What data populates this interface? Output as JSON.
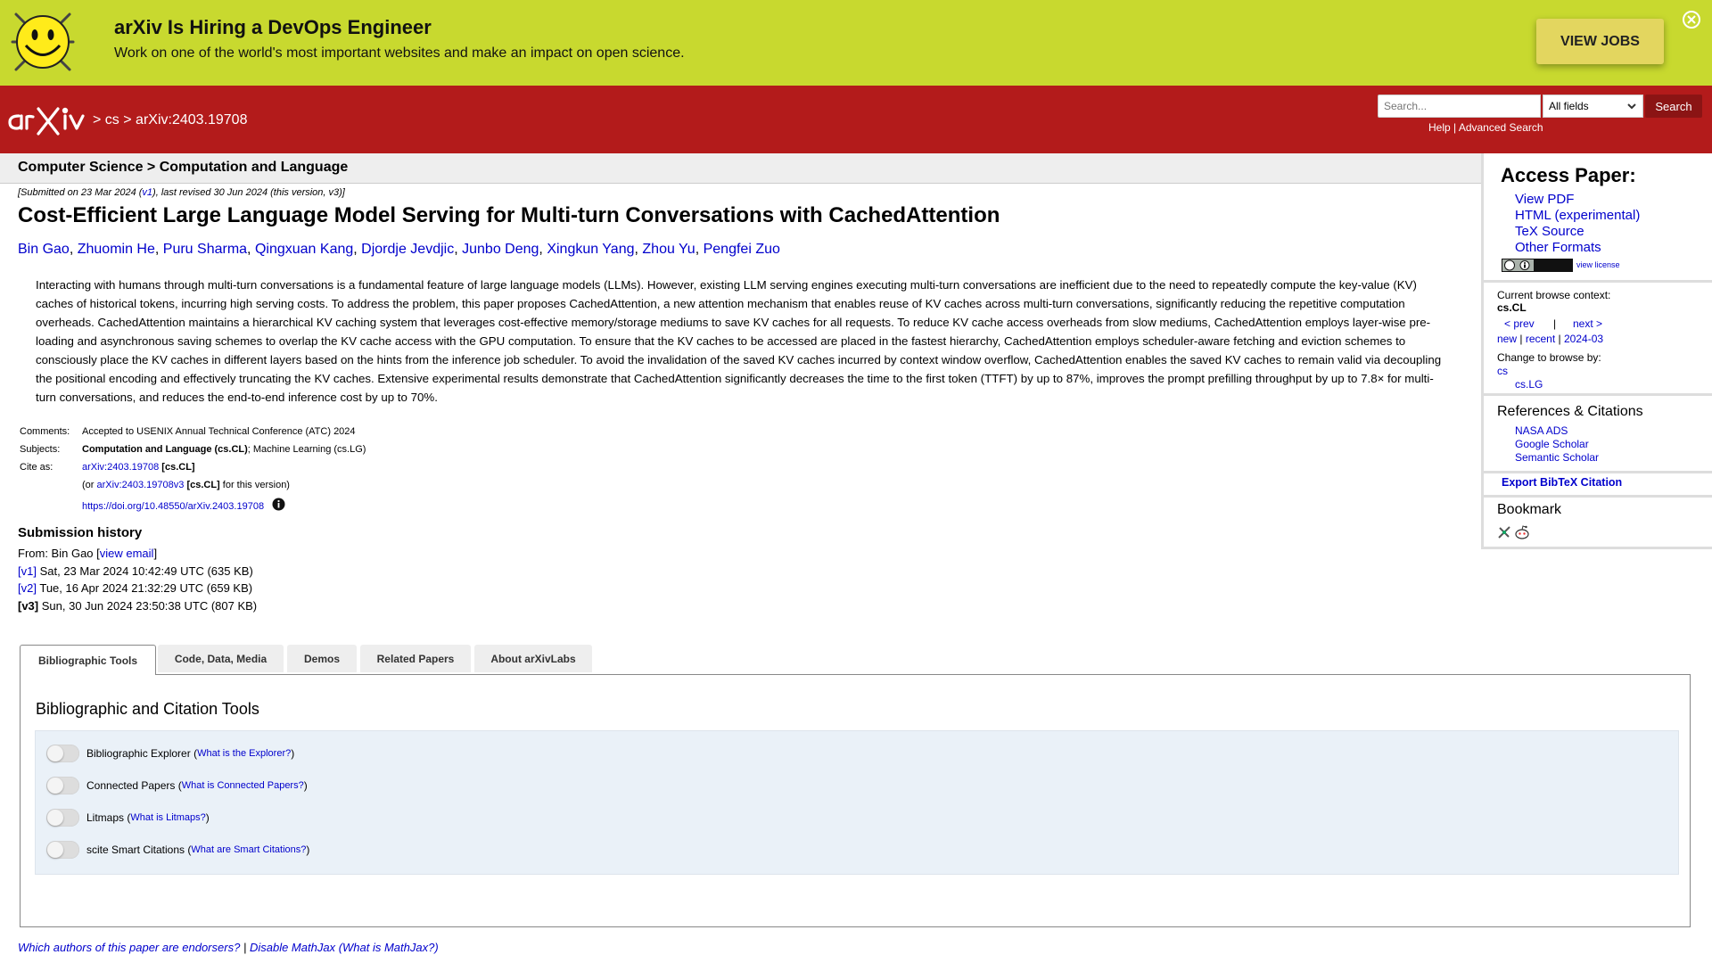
{
  "banner": {
    "title": "arXiv Is Hiring a DevOps Engineer",
    "text": "Work on one of the world's most important websites and make an impact on open science.",
    "button": "VIEW JOBS"
  },
  "header": {
    "breadcrumb_sep": ">",
    "crumb_cs": "cs",
    "crumb_id": "arXiv:2403.19708",
    "search_placeholder": "Search...",
    "field_select": "All fields",
    "search_button": "Search",
    "help": "Help",
    "link_sep": "|",
    "advanced": "Advanced Search"
  },
  "subheader": {
    "title": "Computer Science > Computation and Language"
  },
  "dateline": {
    "part1": "[Submitted on 23 Mar 2024 (",
    "v1": "v1",
    "part2": "), last revised 30 Jun 2024 (this version, v3)]"
  },
  "paper": {
    "title": "Cost-Efficient Large Language Model Serving for Multi-turn Conversations with CachedAttention",
    "authors": [
      "Bin Gao",
      "Zhuomin He",
      "Puru Sharma",
      "Qingxuan Kang",
      "Djordje Jevdjic",
      "Junbo Deng",
      "Xingkun Yang",
      "Zhou Yu",
      "Pengfei Zuo"
    ],
    "author_sep": ",",
    "abstract": "Interacting with humans through multi-turn conversations is a fundamental feature of large language models (LLMs). However, existing LLM serving engines executing multi-turn conversations are inefficient due to the need to repeatedly compute the key-value (KV) caches of historical tokens, incurring high serving costs. To address the problem, this paper proposes CachedAttention, a new attention mechanism that enables reuse of KV caches across multi-turn conversations, significantly reducing the repetitive computation overheads. CachedAttention maintains a hierarchical KV caching system that leverages cost-effective memory/storage mediums to save KV caches for all requests. To reduce KV cache access overheads from slow mediums, CachedAttention employs layer-wise pre-loading and asynchronous saving schemes to overlap the KV cache access with the GPU computation. To ensure that the KV caches to be accessed are placed in the fastest hierarchy, CachedAttention employs scheduler-aware fetching and eviction schemes to consciously place the KV caches in different layers based on the hints from the inference job scheduler. To avoid the invalidation of the saved KV caches incurred by context window overflow, CachedAttention enables the saved KV caches to remain valid via decoupling the positional encoding and effectively truncating the KV caches. Extensive experimental results demonstrate that CachedAttention significantly decreases the time to the first token (TTFT) by up to 87%, improves the prompt prefilling throughput by up to 7.8× for multi-turn conversations, and reduces the end-to-end inference cost by up to 70%."
  },
  "meta": {
    "comments_label": "Comments:",
    "comments": "Accepted to USENIX Annual Technical Conference (ATC) 2024",
    "subjects_label": "Subjects:",
    "subject_primary": "Computation and Language (cs.CL)",
    "subject_secondary": "; Machine Learning (cs.LG)",
    "cite_label": "Cite as:",
    "cite_id": "arXiv:2403.19708",
    "cite_tag": "[cs.CL]",
    "or_open": "(or",
    "cite_v3": "arXiv:2403.19708v3",
    "cite_v3_tag": "[cs.CL]",
    "cite_v3_tail": "for this version)",
    "doi": "https://doi.org/10.48550/arXiv.2403.19708"
  },
  "submission": {
    "heading": "Submission history",
    "from_prefix": "From: Bin Gao [",
    "view_email": "view email",
    "from_suffix": "]",
    "versions": [
      {
        "tag": "[v1]",
        "text": "Sat, 23 Mar 2024 10:42:49 UTC (635 KB)"
      },
      {
        "tag": "[v2]",
        "text": "Tue, 16 Apr 2024 21:32:29 UTC (659 KB)"
      },
      {
        "tag": "[v3]",
        "text": "Sun, 30 Jun 2024 23:50:38 UTC (807 KB)"
      }
    ]
  },
  "labs": {
    "tabs": [
      "Bibliographic Tools",
      "Code, Data, Media",
      "Demos",
      "Related Papers",
      "About arXivLabs"
    ],
    "heading": "Bibliographic and Citation Tools",
    "tools": [
      {
        "label": "Bibliographic Explorer",
        "link": "What is the Explorer?"
      },
      {
        "label": "Connected Papers",
        "link": "What is Connected Papers?"
      },
      {
        "label": "Litmaps",
        "link": "What is Litmaps?"
      },
      {
        "label": "scite Smart Citations",
        "link": "What are Smart Citations?"
      }
    ],
    "paren_open": "(",
    "paren_close": ")"
  },
  "footer": {
    "endorsers": "Which authors of this paper are endorsers?",
    "sep": "|",
    "mathjax": "Disable MathJax",
    "mathjax_what": "(What is MathJax?)"
  },
  "sidebar": {
    "access_heading": "Access Paper:",
    "formats": [
      "View PDF",
      "HTML (experimental)",
      "TeX Source",
      "Other Formats"
    ],
    "view_license": "view license",
    "browse_context_label": "Current browse context:",
    "browse_context": "cs.CL",
    "prev": "< prev",
    "pipe": "|",
    "next": "next >",
    "new": "new",
    "recent": "recent",
    "month": "2024-03",
    "change_browse": "Change to browse by:",
    "browse_cs": "cs",
    "browse_lg": "cs.LG",
    "refs_heading": "References & Citations",
    "refs": [
      "NASA ADS",
      "Google Scholar",
      "Semantic Scholar"
    ],
    "export": "Export BibTeX Citation",
    "bookmark": "Bookmark"
  },
  "colors": {
    "banner_bg": "#c8d92f",
    "header_bg": "#b31b1b",
    "link": "#0000cc"
  }
}
